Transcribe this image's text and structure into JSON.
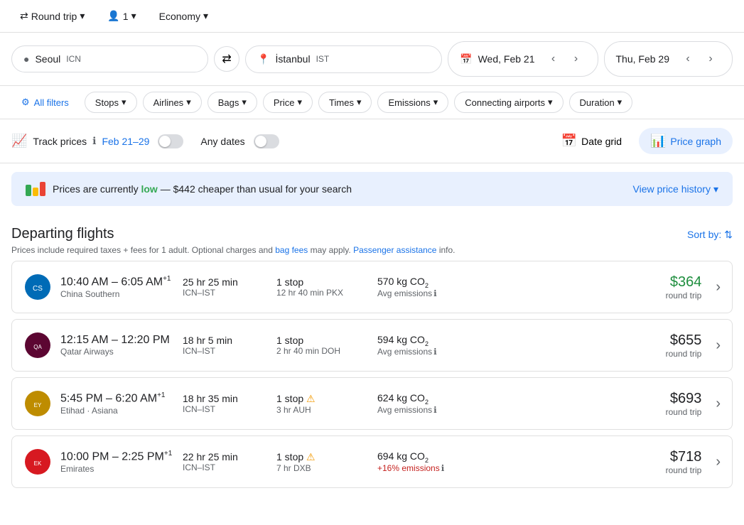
{
  "topbar": {
    "trip_type": "Round trip",
    "passengers": "1",
    "class": "Economy",
    "chevron": "▾"
  },
  "search": {
    "origin": "Seoul",
    "origin_code": "ICN",
    "destination": "İstanbul",
    "destination_code": "IST",
    "depart_date": "Wed, Feb 21",
    "return_date": "Thu, Feb 29",
    "calendar_icon": "📅"
  },
  "filters": {
    "all_filters": "All filters",
    "stops": "Stops",
    "airlines": "Airlines",
    "bags": "Bags",
    "price": "Price",
    "times": "Times",
    "emissions": "Emissions",
    "connecting_airports": "Connecting airports",
    "duration": "Duration"
  },
  "track": {
    "label": "Track prices",
    "dates": "Feb 21–29",
    "any_dates": "Any dates",
    "date_grid": "Date grid",
    "price_graph": "Price graph"
  },
  "price_banner": {
    "text_before": "Prices are currently ",
    "low_text": "low",
    "text_after": " — $442 cheaper than usual for your search",
    "view_history": "View price history",
    "bars": [
      {
        "color": "#34a853",
        "height": 16
      },
      {
        "color": "#fbbc04",
        "height": 12
      },
      {
        "color": "#ea4335",
        "height": 20
      }
    ]
  },
  "flights_section": {
    "title": "Departing flights",
    "subtitle": "Prices include required taxes + fees for 1 adult. Optional charges and ",
    "bag_fees": "bag fees",
    "subtitle2": " may apply. ",
    "passenger_assistance": "Passenger assistance",
    "subtitle3": " info.",
    "sort_by": "Sort by:"
  },
  "flights": [
    {
      "airline_name": "China Southern",
      "depart_time": "10:40 AM",
      "arrive_time": "6:05 AM",
      "arrive_suffix": "+1",
      "duration": "25 hr 25 min",
      "route": "ICN–IST",
      "stops": "1 stop",
      "via": "12 hr 40 min PKX",
      "co2": "570 kg CO",
      "co2_sub": "2",
      "emissions_label": "Avg emissions",
      "price": "$364",
      "price_class": "low",
      "price_type": "round trip",
      "warning": false,
      "airline_color": "#006BB6"
    },
    {
      "airline_name": "Qatar Airways",
      "depart_time": "12:15 AM",
      "arrive_time": "12:20 PM",
      "arrive_suffix": "",
      "duration": "18 hr 5 min",
      "route": "ICN–IST",
      "stops": "1 stop",
      "via": "2 hr 40 min DOH",
      "co2": "594 kg CO",
      "co2_sub": "2",
      "emissions_label": "Avg emissions",
      "price": "$655",
      "price_class": "",
      "price_type": "round trip",
      "warning": false,
      "airline_color": "#5c0632"
    },
    {
      "airline_name": "Etihad · Asiana",
      "depart_time": "5:45 PM",
      "arrive_time": "6:20 AM",
      "arrive_suffix": "+1",
      "duration": "18 hr 35 min",
      "route": "ICN–IST",
      "stops": "1 stop",
      "via": "3 hr AUH",
      "co2": "624 kg CO",
      "co2_sub": "2",
      "emissions_label": "Avg emissions",
      "price": "$693",
      "price_class": "",
      "price_type": "round trip",
      "warning": true,
      "airline_color": "#be8c00"
    },
    {
      "airline_name": "Emirates",
      "depart_time": "10:00 PM",
      "arrive_time": "2:25 PM",
      "arrive_suffix": "+1",
      "duration": "22 hr 25 min",
      "route": "ICN–IST",
      "stops": "1 stop",
      "via": "7 hr DXB",
      "co2": "694 kg CO",
      "co2_sub": "2",
      "emissions_label": "+16% emissions",
      "price": "$718",
      "price_class": "",
      "price_type": "round trip",
      "warning": true,
      "airline_color": "#d71921"
    }
  ]
}
